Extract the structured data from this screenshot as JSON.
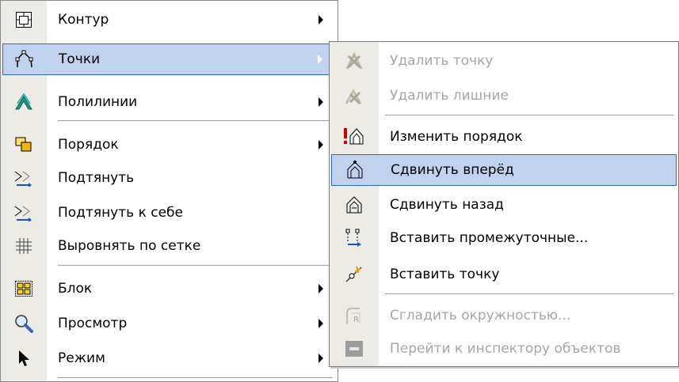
{
  "main_menu": {
    "items": [
      {
        "label": "Контур",
        "icon": "contour-icon",
        "submenu": true
      },
      {
        "label": "Точки",
        "icon": "points-icon",
        "submenu": true,
        "highlighted": true
      },
      {
        "label": "Полилинии",
        "icon": "polylines-icon",
        "submenu": true
      },
      {
        "label": "Порядок",
        "icon": "order-icon",
        "submenu": true
      },
      {
        "label": "Подтянуть",
        "icon": "snap-icon"
      },
      {
        "label": "Подтянуть к себе",
        "icon": "snap-to-self-icon"
      },
      {
        "label": "Выровнять по сетке",
        "icon": "grid-icon"
      },
      {
        "label": "Блок",
        "icon": "block-icon",
        "submenu": true
      },
      {
        "label": "Просмотр",
        "icon": "magnifier-icon",
        "submenu": true
      },
      {
        "label": "Режим",
        "icon": "cursor-icon",
        "submenu": true
      }
    ]
  },
  "sub_menu": {
    "items": [
      {
        "label": "Удалить точку",
        "icon": "delete-point-icon",
        "disabled": true
      },
      {
        "label": "Удалить лишние",
        "icon": "delete-extra-icon",
        "disabled": true
      },
      {
        "label": "Изменить порядок",
        "icon": "change-order-icon"
      },
      {
        "label": "Сдвинуть вперёд",
        "icon": "move-forward-icon",
        "highlighted": true
      },
      {
        "label": "Сдвинуть назад",
        "icon": "move-back-icon"
      },
      {
        "label": "Вставить промежуточные...",
        "icon": "insert-intermediate-icon"
      },
      {
        "label": "Вставить точку",
        "icon": "insert-point-icon"
      },
      {
        "label": "Сгладить окружностью...",
        "icon": "smooth-circle-icon",
        "disabled": true
      },
      {
        "label": "Перейти к инспектору объектов",
        "icon": "object-inspector-icon",
        "disabled": true
      }
    ]
  },
  "colors": {
    "highlight_bg": "#c1d2ee",
    "highlight_border": "#316ac5",
    "disabled_text": "#a6a6a6",
    "gutter": "#ecebe6"
  }
}
